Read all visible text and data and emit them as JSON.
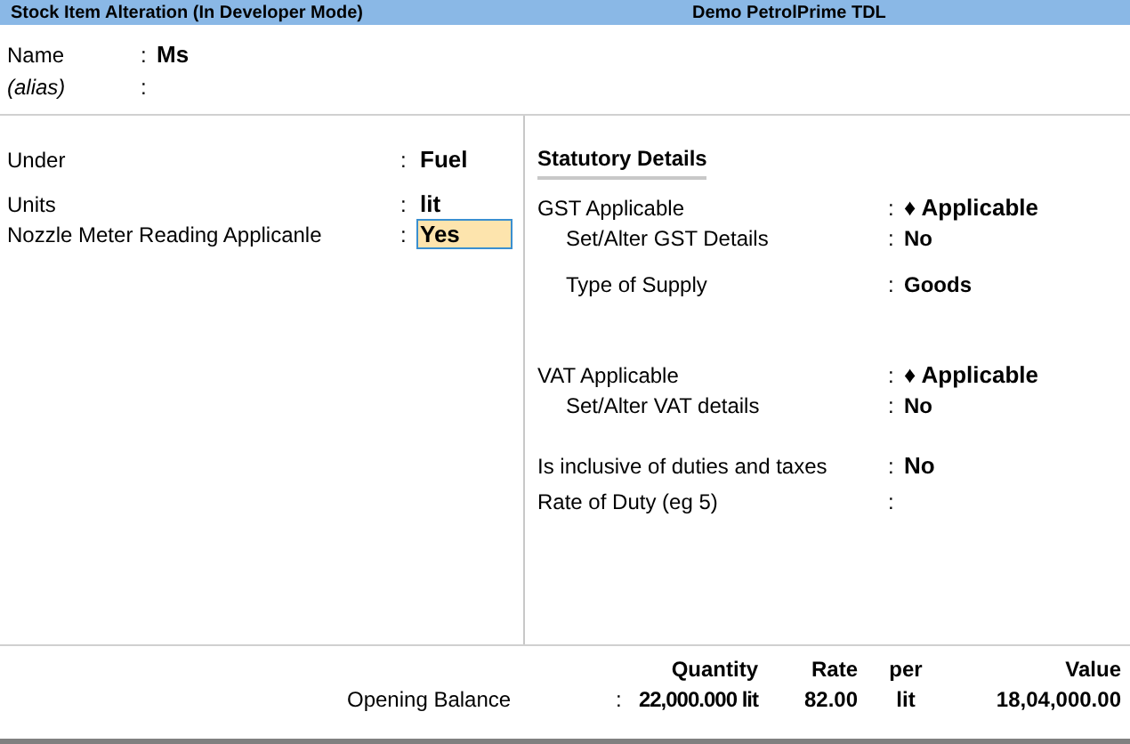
{
  "title_bar": {
    "title": "Stock Item Alteration (In Developer Mode)",
    "company": "Demo PetrolPrime TDL"
  },
  "header_fields": [
    {
      "label": "Name",
      "colon": ":",
      "value": "Ms",
      "italic": false
    },
    {
      "label": "(alias)",
      "colon": ":",
      "italic": true
    }
  ],
  "left_fields": [
    {
      "label": "Under",
      "colon": ":",
      "value": "Fuel",
      "focused": false
    },
    {
      "label": "Units",
      "colon": ":",
      "value": "lit",
      "focused": false
    },
    {
      "label": "Nozzle Meter Reading Applicanle",
      "colon": ":",
      "value": "Yes",
      "focused": true
    }
  ],
  "statutory": {
    "title": "Statutory Details",
    "groups": [
      {
        "label": "GST Applicable",
        "colon": ":",
        "value": "♦ Applicable",
        "children": [
          {
            "label": "Set/Alter GST Details",
            "colon": ":",
            "value": "No"
          },
          {
            "label": "Type of Supply",
            "colon": ":",
            "value": "Goods"
          }
        ]
      },
      {
        "label": "VAT Applicable",
        "colon": ":",
        "value": "♦ Applicable",
        "children": [
          {
            "label": "Set/Alter VAT details",
            "colon": ":",
            "value": "No"
          }
        ]
      },
      {
        "label": "Is inclusive of duties and taxes",
        "colon": ":",
        "value": "No"
      },
      {
        "label": "Rate of Duty (eg 5)",
        "colon": ":"
      }
    ]
  },
  "opening_balance": {
    "columns": [
      "Quantity",
      "Rate",
      "per",
      "Value"
    ],
    "label": "Opening Balance",
    "colon": ":",
    "quantity": "22,000.000 lit",
    "rate": "82.00",
    "per": "lit",
    "value": "18,04,000.00"
  }
}
